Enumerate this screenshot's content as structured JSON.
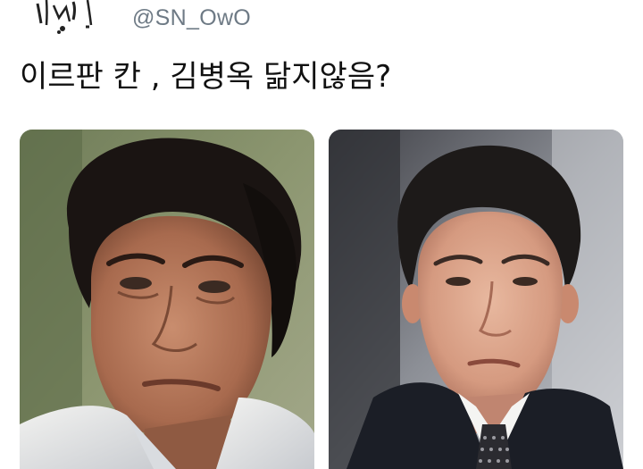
{
  "tweet": {
    "handle": "@SN_OwO",
    "text": "이르판 칸 , 김병옥 닮지않음?"
  },
  "media": {
    "count": 2,
    "photos": [
      {
        "name": "photo-left"
      },
      {
        "name": "photo-right"
      }
    ]
  }
}
